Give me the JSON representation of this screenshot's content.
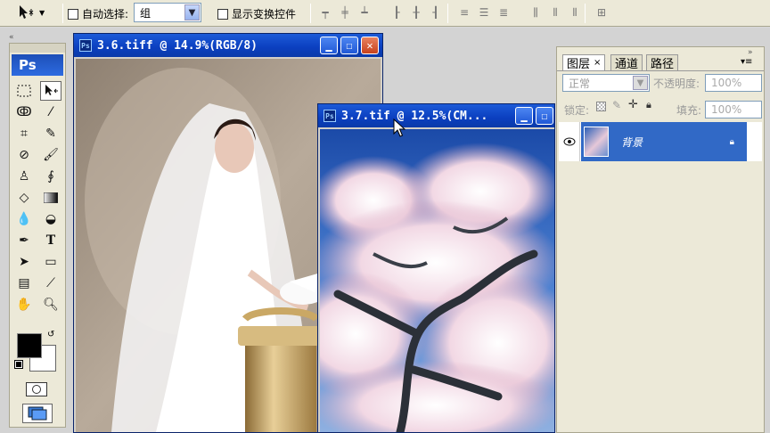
{
  "options_bar": {
    "auto_select_label": "自动选择:",
    "auto_select_value": "组",
    "show_transform_label": "显示变换控件"
  },
  "toolbox": {
    "logo": "Ps"
  },
  "doc1": {
    "title": "3.6.tiff @ 14.9%(RGB/8)"
  },
  "doc2": {
    "title": "3.7.tif @ 12.5%(CM..."
  },
  "layers_panel": {
    "tabs": [
      "图层",
      "通道",
      "路径"
    ],
    "blend_mode": "正常",
    "opacity_label": "不透明度:",
    "opacity_value": "100%",
    "lock_label": "锁定:",
    "fill_label": "填充:",
    "fill_value": "100%",
    "layer_name": "背景"
  },
  "colors": {
    "title_blue": "#0b3fbf",
    "layer_selected": "#3169c6",
    "foreground": "#000000",
    "background": "#ffffff"
  }
}
